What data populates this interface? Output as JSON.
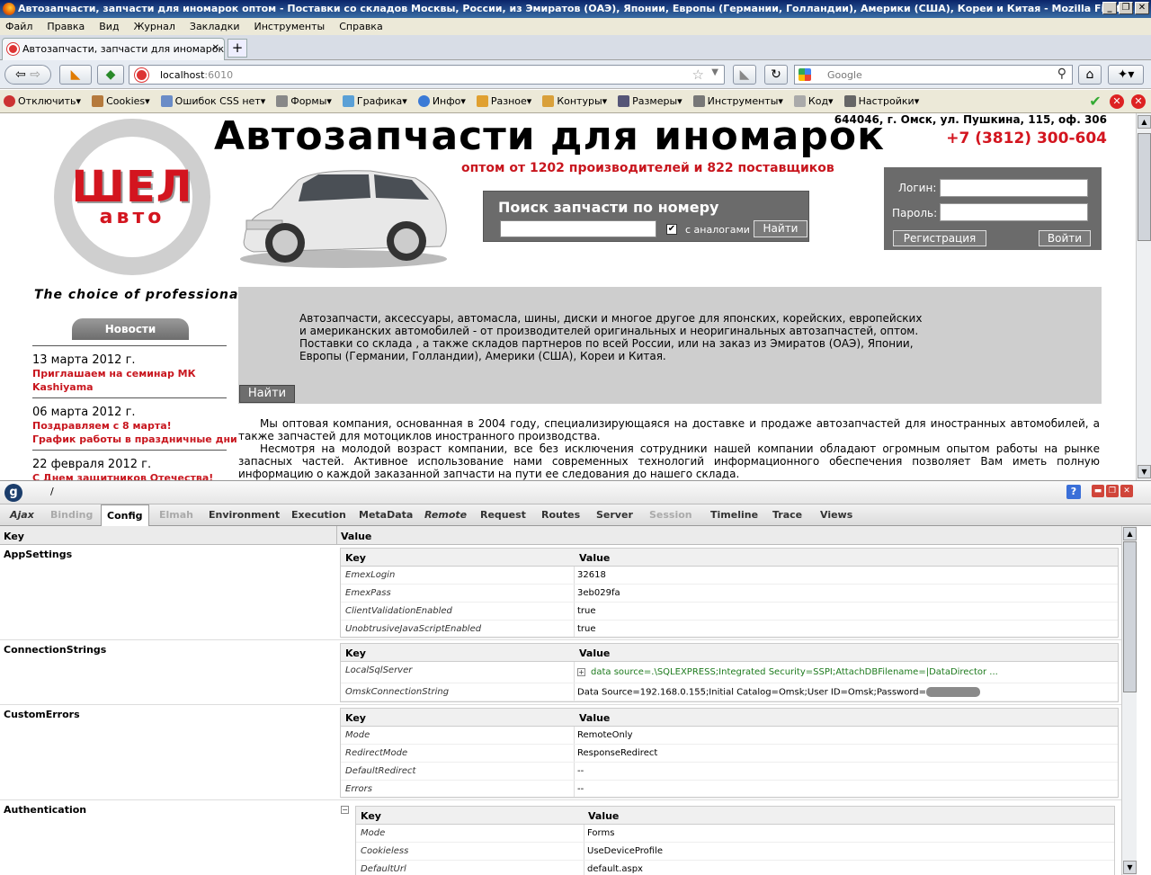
{
  "window": {
    "title": "Автозапчасти, запчасти для иномарок оптом - Поставки со складов Москвы, России, из Эмиратов (ОАЭ), Японии, Европы (Германии, Голландии), Америки (США), Кореи и Китая - Mozilla Firefox"
  },
  "menu": [
    "Файл",
    "Правка",
    "Вид",
    "Журнал",
    "Закладки",
    "Инструменты",
    "Справка"
  ],
  "tab": {
    "title": "Автозапчасти, запчасти для иномарок оп..."
  },
  "url": {
    "host": "localhost",
    "port": ":6010"
  },
  "search": {
    "placeholder": "Google"
  },
  "devtoolbar": [
    "Отключить▾",
    "Cookies▾",
    "Ошибок CSS нет▾",
    "Формы▾",
    "Графика▾",
    "Инфо▾",
    "Разное▾",
    "Контуры▾",
    "Размеры▾",
    "Инструменты▾",
    "Код▾",
    "Настройки▾"
  ],
  "site": {
    "logo_top": "ШЕЛ",
    "logo_bottom": "авто",
    "headline": "Автозапчасти для иномарок",
    "subline": "оптом от 1202 производителей и 822 поставщиков",
    "search_title": "Поиск запчасти по номеру",
    "search_checkbox": "с аналогами",
    "search_btn": "Найти",
    "address": "644046, г. Омск, ул. Пушкина, 115, оф. 306",
    "phone": "+7 (3812) 300-604",
    "login_label": "Логин:",
    "password_label": "Пароль:",
    "register_btn": "Регистрация",
    "login_btn": "Войти",
    "tagline": "The choice of professionals",
    "news_tab": "Новости",
    "news": [
      {
        "date": "13 марта 2012 г.",
        "links": [
          "Приглашаем на семинар МК",
          "Kashiyama"
        ]
      },
      {
        "date": "06 марта 2012 г.",
        "links": [
          "Поздравляем с 8 марта!",
          "График работы в праздничные дни"
        ]
      },
      {
        "date": "22 февраля 2012 г.",
        "links": [
          "С Днем защитников Отечества!"
        ]
      }
    ],
    "promo": "Автозапчасти, аксессуары, автомасла, шины, диски и многое другое для японских, корейских, европейских и американских автомобилей - от производителей оригинальных и неоригинальных автозапчастей, оптом. Поставки со склада , а также складов партнеров по всей России, или на заказ из Эмиратов (ОАЭ), Японии, Европы (Германии, Голландии), Америки (США), Кореи и Китая.",
    "promo_btn": "Найти",
    "para1": "Мы оптовая компания, основанная в 2004 году, специализирующаяся на доставке и продаже автозапчастей для иностранных автомобилей, а также запчастей для мотоциклов иностранного производства.",
    "para2": "Несмотря на молодой возраст компании, все без исключения сотрудники нашей компании обладают огромным опытом работы на рынке запасных частей. Активное использование нами современных технологий информационного обеспечения позволяет Вам иметь полную информацию о каждой заказанной запчасти на пути ее следования до нашего склада."
  },
  "glimpse": {
    "path": "/",
    "tabs": [
      "Ajax",
      "Binding",
      "Config",
      "Elmah",
      "Environment",
      "Execution",
      "MetaData",
      "Remote",
      "Request",
      "Routes",
      "Server",
      "Session",
      "Timeline",
      "Trace",
      "Views"
    ],
    "active_tab": "Config",
    "col_key": "Key",
    "col_value": "Value",
    "sections": [
      {
        "name": "AppSettings",
        "rows": [
          [
            "EmexLogin",
            "32618"
          ],
          [
            "EmexPass",
            "3eb029fa"
          ],
          [
            "ClientValidationEnabled",
            "true"
          ],
          [
            "UnobtrusiveJavaScriptEnabled",
            "true"
          ]
        ]
      },
      {
        "name": "ConnectionStrings",
        "rows": [
          [
            "LocalSqlServer",
            "data source=.\\SQLEXPRESS;Integrated Security=SSPI;AttachDBFilename=|DataDirector ..."
          ],
          [
            "OmskConnectionString",
            "Data Source=192.168.0.155;Initial Catalog=Omsk;User ID=Omsk;Password="
          ]
        ]
      },
      {
        "name": "CustomErrors",
        "rows": [
          [
            "Mode",
            "RemoteOnly"
          ],
          [
            "RedirectMode",
            "ResponseRedirect"
          ],
          [
            "DefaultRedirect",
            "--"
          ],
          [
            "Errors",
            "--"
          ]
        ]
      },
      {
        "name": "Authentication",
        "rows": [
          [
            "Mode",
            "Forms"
          ],
          [
            "Cookieless",
            "UseDeviceProfile"
          ],
          [
            "DefaultUrl",
            "default.aspx"
          ]
        ]
      }
    ]
  }
}
